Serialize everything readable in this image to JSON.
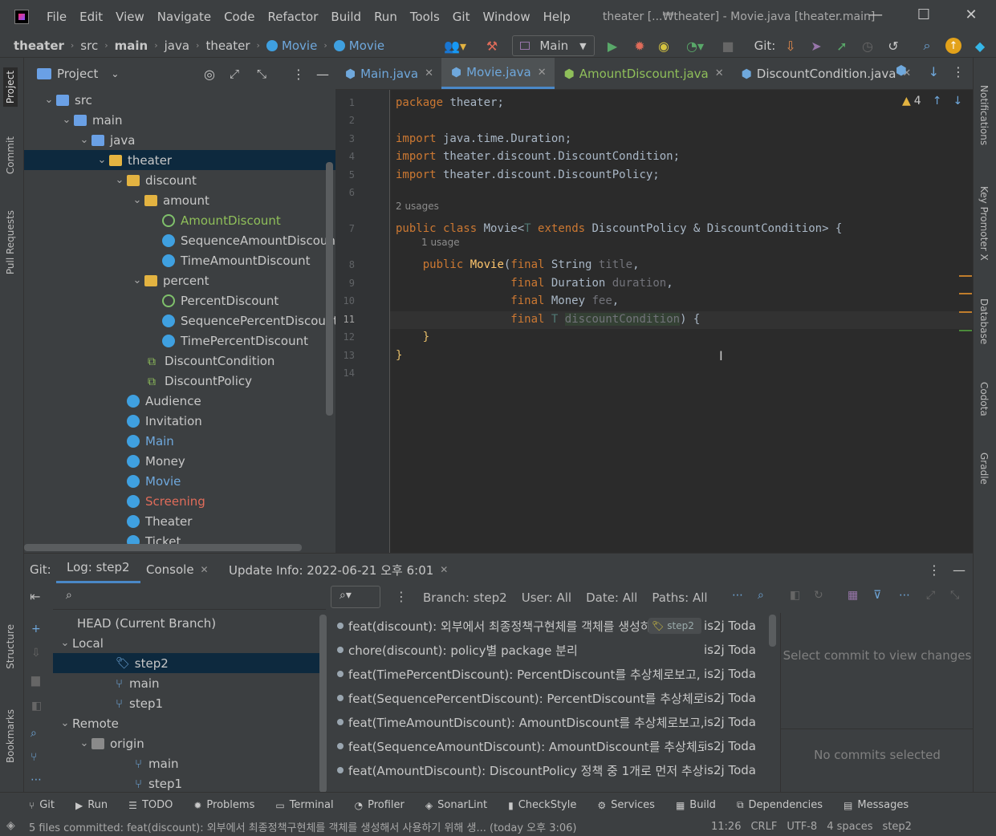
{
  "app": {
    "window_title": "theater [...₩theater] - Movie.java [theater.main]"
  },
  "menu": [
    "File",
    "Edit",
    "View",
    "Navigate",
    "Code",
    "Refactor",
    "Build",
    "Run",
    "Tools",
    "Git",
    "Window",
    "Help"
  ],
  "breadcrumb": [
    "theater",
    "src",
    "main",
    "java",
    "theater",
    "Movie",
    "Movie"
  ],
  "toolbar": {
    "run_config": "Main",
    "git_label": "Git:"
  },
  "side_tabs": {
    "left": [
      "Project",
      "Commit",
      "Pull Requests",
      "Structure",
      "Bookmarks"
    ],
    "right": [
      "Notifications",
      "Key Promoter X",
      "Database",
      "Codota",
      "Gradle"
    ]
  },
  "project": {
    "title": "Project",
    "tree": [
      {
        "label": "src",
        "depth": 1,
        "kind": "folderb",
        "open": true
      },
      {
        "label": "main",
        "depth": 2,
        "kind": "folderb",
        "open": true
      },
      {
        "label": "java",
        "depth": 3,
        "kind": "folderb",
        "open": true
      },
      {
        "label": "theater",
        "depth": 4,
        "kind": "folder",
        "open": true,
        "selected": true
      },
      {
        "label": "discount",
        "depth": 5,
        "kind": "folder",
        "open": true
      },
      {
        "label": "amount",
        "depth": 6,
        "kind": "folder",
        "open": true
      },
      {
        "label": "AmountDiscount",
        "depth": 7,
        "kind": "acls",
        "color": "#8fbf5a"
      },
      {
        "label": "SequenceAmountDiscoun",
        "depth": 7,
        "kind": "cls"
      },
      {
        "label": "TimeAmountDiscount",
        "depth": 7,
        "kind": "cls"
      },
      {
        "label": "percent",
        "depth": 6,
        "kind": "folder",
        "open": true
      },
      {
        "label": "PercentDiscount",
        "depth": 7,
        "kind": "acls"
      },
      {
        "label": "SequencePercentDiscount",
        "depth": 7,
        "kind": "cls"
      },
      {
        "label": "TimePercentDiscount",
        "depth": 7,
        "kind": "cls"
      },
      {
        "label": "DiscountCondition",
        "depth": 6,
        "kind": "ifc"
      },
      {
        "label": "DiscountPolicy",
        "depth": 6,
        "kind": "ifc"
      },
      {
        "label": "Audience",
        "depth": 5,
        "kind": "cls"
      },
      {
        "label": "Invitation",
        "depth": 5,
        "kind": "cls"
      },
      {
        "label": "Main",
        "depth": 5,
        "kind": "cls",
        "color": "#6fa8dc"
      },
      {
        "label": "Money",
        "depth": 5,
        "kind": "cls"
      },
      {
        "label": "Movie",
        "depth": 5,
        "kind": "cls",
        "color": "#6fa8dc"
      },
      {
        "label": "Screening",
        "depth": 5,
        "kind": "cls",
        "color": "#e06c5a"
      },
      {
        "label": "Theater",
        "depth": 5,
        "kind": "cls"
      },
      {
        "label": "Ticket",
        "depth": 5,
        "kind": "cls"
      }
    ]
  },
  "editor": {
    "tabs": [
      {
        "label": "Main.java",
        "active": false,
        "color": "#6fa8dc"
      },
      {
        "label": "Movie.java",
        "active": true,
        "color": "#6fa8dc"
      },
      {
        "label": "AmountDiscount.java",
        "active": false,
        "color": "#8fbf5a"
      },
      {
        "label": "DiscountCondition.java",
        "active": false,
        "color": "#c8c8c8"
      }
    ],
    "warnings": "4",
    "line_numbers": [
      "1",
      "2",
      "3",
      "4",
      "5",
      "6",
      "7",
      "8",
      "9",
      "10",
      "11",
      "12",
      "13",
      "14"
    ],
    "hints": {
      "usages2": "2 usages",
      "usage1": "1 usage"
    }
  },
  "git": {
    "tabs": [
      "Git:",
      "Log: step2",
      "Console",
      "Update Info: 2022-06-21 오후 6:01"
    ],
    "branches": [
      {
        "label": "HEAD (Current Branch)",
        "depth": 0
      },
      {
        "label": "Local",
        "depth": 0,
        "open": true
      },
      {
        "label": "step2",
        "depth": 2,
        "selected": true,
        "tag": true
      },
      {
        "label": "main",
        "depth": 2
      },
      {
        "label": "step1",
        "depth": 2
      },
      {
        "label": "Remote",
        "depth": 0,
        "open": true
      },
      {
        "label": "origin",
        "depth": 1,
        "open": true
      },
      {
        "label": "main",
        "depth": 3
      },
      {
        "label": "step1",
        "depth": 3
      }
    ],
    "filters": {
      "branch": "Branch: step2",
      "user": "User: All",
      "date": "Date: All",
      "paths": "Paths: All"
    },
    "commits": [
      {
        "msg": "feat(discount): 외부에서 최종정책구현체를 객체를 생성하",
        "author": "is2j Toda",
        "tag": "step2"
      },
      {
        "msg": "chore(discount): policy별 package 분리",
        "author": "is2j Toda"
      },
      {
        "msg": "feat(TimePercentDiscount): PercentDiscount를 추상체로보고, 정책",
        "author": "is2j Toda"
      },
      {
        "msg": "feat(SequencePercentDiscount): PercentDiscount를 추상체로보고,",
        "author": "is2j Toda"
      },
      {
        "msg": "feat(TimeAmountDiscount): AmountDiscount를 추상체로보고, 정책",
        "author": "is2j Toda"
      },
      {
        "msg": "feat(SequenceAmountDiscount): AmountDiscount를 추상체로보고,",
        "author": "is2j Toda"
      },
      {
        "msg": "feat(AmountDiscount): DiscountPolicy 정책 중 1개로 먼저 추상화",
        "author": "is2j Toda"
      }
    ],
    "details": {
      "select_msg": "Select commit to view changes",
      "no_commits": "No commits selected"
    }
  },
  "statusbar": [
    "Git",
    "Run",
    "TODO",
    "Problems",
    "Terminal",
    "Profiler",
    "SonarLint",
    "CheckStyle",
    "Services",
    "Build",
    "Dependencies",
    "Messages"
  ],
  "message": {
    "text": "5 files committed: feat(discount): 외부에서 최종정책구현체를 객체를 생성해서 사용하기 위해 생... (today 오후 3:06)",
    "position": "11:26",
    "line_sep": "CRLF",
    "encoding": "UTF-8",
    "indent": "4 spaces",
    "branch": "step2"
  }
}
